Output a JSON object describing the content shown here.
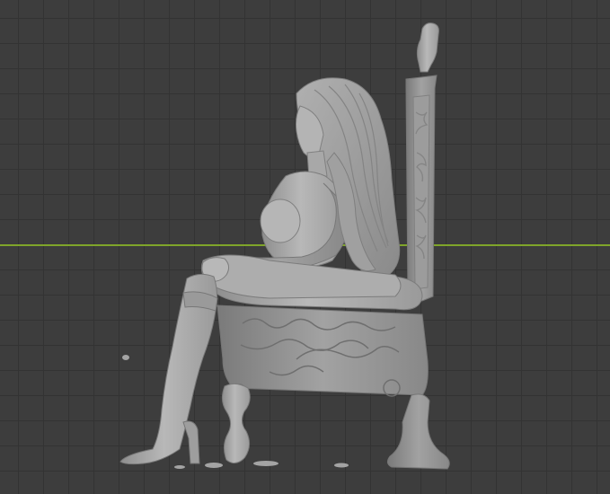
{
  "viewport": {
    "background_color": "#3d3d3d",
    "grid_line_color": "#333333",
    "x_axis_color": "#7fa52a",
    "model_color": "#a4a4a4"
  },
  "model": {
    "subject": "seated-figure-on-ornate-throne",
    "shading": "solid-gray"
  }
}
